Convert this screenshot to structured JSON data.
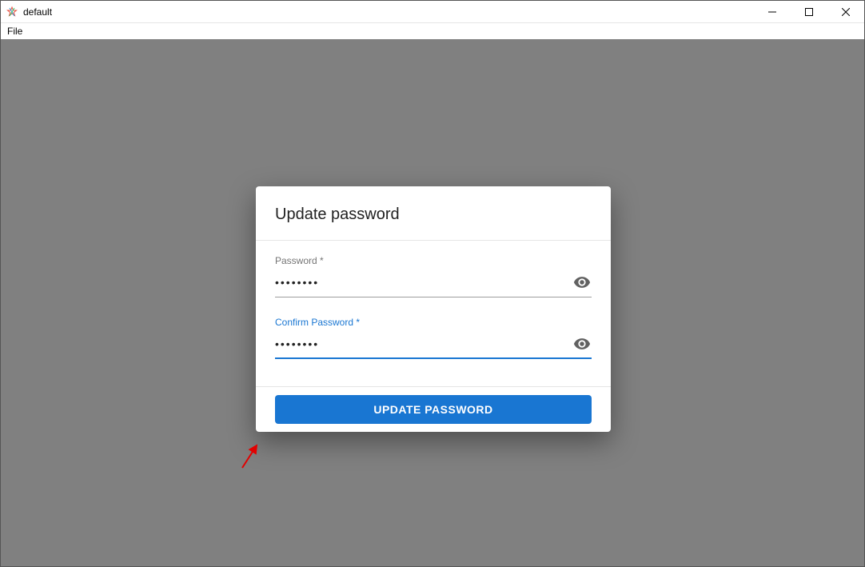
{
  "window": {
    "title": "default",
    "menus": {
      "file": "File"
    }
  },
  "dialog": {
    "title": "Update password",
    "password": {
      "label": "Password *",
      "masked_value": "••••••••"
    },
    "confirm": {
      "label": "Confirm Password *",
      "masked_value": "••••••••"
    },
    "submit_label": "UPDATE PASSWORD"
  }
}
